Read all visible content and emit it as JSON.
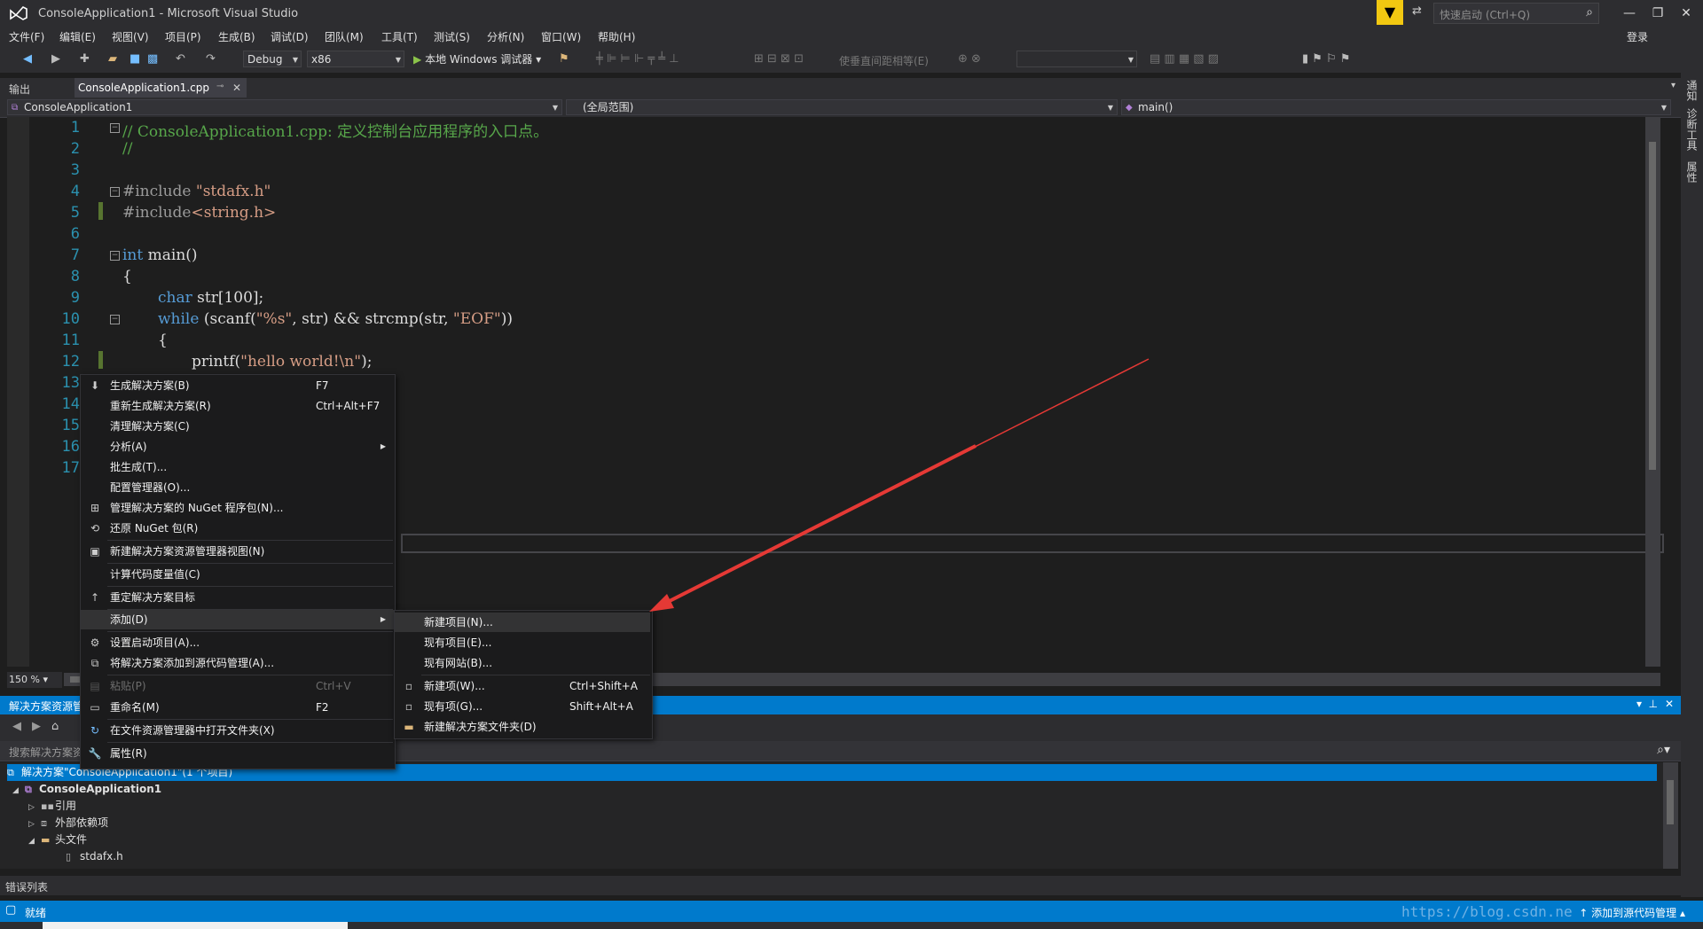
{
  "window": {
    "title": "ConsoleApplication1 - Microsoft Visual Studio",
    "quick_launch_placeholder": "快速启动 (Ctrl+Q)",
    "login": "登录"
  },
  "menubar": [
    "文件(F)",
    "编辑(E)",
    "视图(V)",
    "项目(P)",
    "生成(B)",
    "调试(D)",
    "团队(M)",
    "工具(T)",
    "测试(S)",
    "分析(N)",
    "窗口(W)",
    "帮助(H)"
  ],
  "toolbar": {
    "config": "Debug",
    "platform": "x86",
    "run_label": "本地 Windows 调试器",
    "vspace_label": "使垂直间距相等(E)"
  },
  "tabs": {
    "output": "输出",
    "active_file": "ConsoleApplication1.cpp"
  },
  "navbar": {
    "project": "ConsoleApplication1",
    "scope": "(全局范围)",
    "member": "main()"
  },
  "editor": {
    "line_numbers": [
      "1",
      "2",
      "3",
      "4",
      "5",
      "6",
      "7",
      "8",
      "9",
      "10",
      "11",
      "12",
      "13",
      "14",
      "15",
      "16",
      "17"
    ],
    "zoom": "150 %",
    "lines": {
      "l1": "// ConsoleApplication1.cpp: 定义控制台应用程序的入口点。",
      "l2": "//",
      "l4_kw": "#include ",
      "l4_str": "\"stdafx.h\"",
      "l5_kw": "#include",
      "l5_str": "<string.h>",
      "l7_kw": "int",
      "l7_rest": " main()",
      "l8": "{",
      "l9_kw": "char",
      "l9_rest": " str[100];",
      "l10_kw": "while",
      "l10_a": " (scanf(",
      "l10_s1": "\"%s\"",
      "l10_b": ", str) && strcmp(str, ",
      "l10_s2": "\"EOF\"",
      "l10_c": "))",
      "l11": "{",
      "l12_a": "printf(",
      "l12_s": "\"hello world!\\n\"",
      "l12_b": ");"
    }
  },
  "context_menu": {
    "items": [
      {
        "label": "生成解决方案(B)",
        "shortcut": "F7",
        "icon": "build-icon"
      },
      {
        "label": "重新生成解决方案(R)",
        "shortcut": "Ctrl+Alt+F7",
        "icon": ""
      },
      {
        "label": "清理解决方案(C)",
        "shortcut": "",
        "icon": ""
      },
      {
        "label": "分析(A)",
        "shortcut": "",
        "icon": ""
      },
      {
        "label": "批生成(T)...",
        "shortcut": "",
        "icon": ""
      },
      {
        "label": "配置管理器(O)...",
        "shortcut": "",
        "icon": ""
      },
      {
        "label": "管理解决方案的 NuGet 程序包(N)...",
        "shortcut": "",
        "icon": "nuget-icon"
      },
      {
        "label": "还原 NuGet 包(R)",
        "shortcut": "",
        "icon": "restore-icon"
      },
      {
        "label": "新建解决方案资源管理器视图(N)",
        "shortcut": "",
        "icon": "new-view-icon"
      },
      {
        "label": "计算代码度量值(C)",
        "shortcut": "",
        "icon": ""
      },
      {
        "label": "重定解决方案目标",
        "shortcut": "",
        "icon": "retarget-icon"
      },
      {
        "label": "添加(D)",
        "shortcut": "",
        "icon": ""
      },
      {
        "label": "设置启动项目(A)...",
        "shortcut": "",
        "icon": "gear-icon"
      },
      {
        "label": "将解决方案添加到源代码管理(A)...",
        "shortcut": "",
        "icon": "source-control-icon"
      },
      {
        "label": "粘贴(P)",
        "shortcut": "Ctrl+V",
        "icon": "paste-icon"
      },
      {
        "label": "重命名(M)",
        "shortcut": "F2",
        "icon": "rename-icon"
      },
      {
        "label": "在文件资源管理器中打开文件夹(X)",
        "shortcut": "",
        "icon": "open-folder-icon"
      },
      {
        "label": "属性(R)",
        "shortcut": "",
        "icon": "wrench-icon"
      }
    ]
  },
  "submenu": {
    "items": [
      {
        "label": "新建项目(N)...",
        "shortcut": ""
      },
      {
        "label": "现有项目(E)...",
        "shortcut": ""
      },
      {
        "label": "现有网站(B)...",
        "shortcut": ""
      },
      {
        "label": "新建项(W)...",
        "shortcut": "Ctrl+Shift+A"
      },
      {
        "label": "现有项(G)...",
        "shortcut": "Shift+Alt+A"
      },
      {
        "label": "新建解决方案文件夹(D)",
        "shortcut": ""
      }
    ]
  },
  "solution_explorer": {
    "title": "解决方案资源管",
    "search_placeholder": "搜索解决方案资",
    "solution": "解决方案\"ConsoleApplication1\"(1 个项目)",
    "project": "ConsoleApplication1",
    "references": "引用",
    "external_deps": "外部依赖项",
    "header_files": "头文件",
    "stdafx": "stdafx.h"
  },
  "error_list": "错误列表",
  "status": {
    "ready": "就绪",
    "source_control": "添加到源代码管理",
    "watermark": "https://blog.csdn.ne"
  },
  "side_tabs": [
    "通知",
    "诊断工具",
    "属性"
  ],
  "colors": {
    "accent": "#007acc",
    "arrow": "#e53935",
    "keyword": "#569cd6",
    "string": "#d69d85",
    "comment": "#57a64a"
  }
}
